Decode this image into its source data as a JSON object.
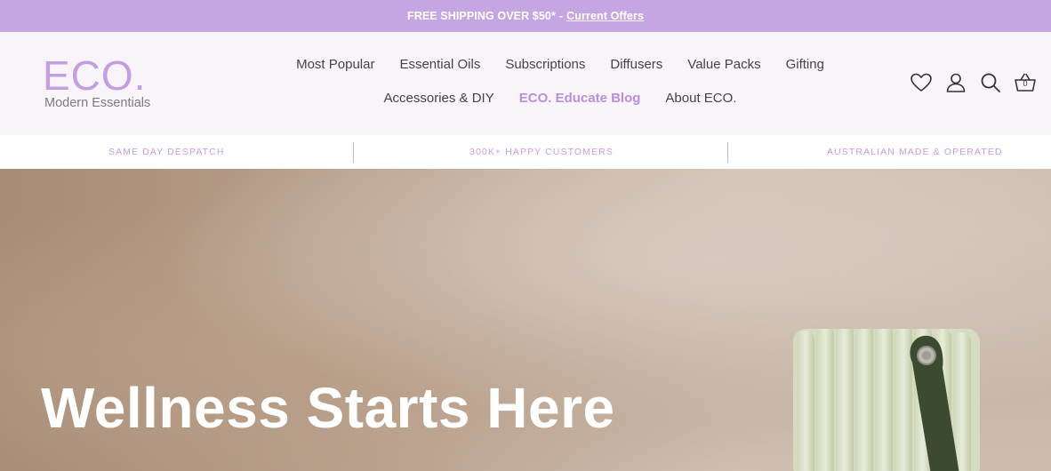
{
  "announcement": {
    "text": "FREE SHIPPING OVER $50*",
    "separator": "-",
    "link": "Current Offers"
  },
  "logo": {
    "mark": "ECO.",
    "tagline": "Modern Essentials"
  },
  "nav": {
    "row1": [
      "Most Popular",
      "Essential Oils",
      "Subscriptions",
      "Diffusers",
      "Value Packs",
      "Gifting"
    ],
    "row2": [
      "Accessories & DIY",
      "ECO. Educate Blog",
      "About ECO."
    ]
  },
  "header_icons": {
    "wishlist": "heart-icon",
    "account": "user-icon",
    "search": "search-icon",
    "cart": "basket-icon",
    "cart_count": "0"
  },
  "usp": [
    "SAME DAY DESPATCH",
    "300K+ HAPPY CUSTOMERS",
    "AUSTRALIAN MADE & OPERATED"
  ],
  "hero": {
    "title": "Wellness Starts Here"
  },
  "colors": {
    "brand_lilac": "#c6a6e2",
    "header_bg": "#f8f4fa",
    "nav_text": "#444444",
    "accent_text": "#b88fd8"
  }
}
